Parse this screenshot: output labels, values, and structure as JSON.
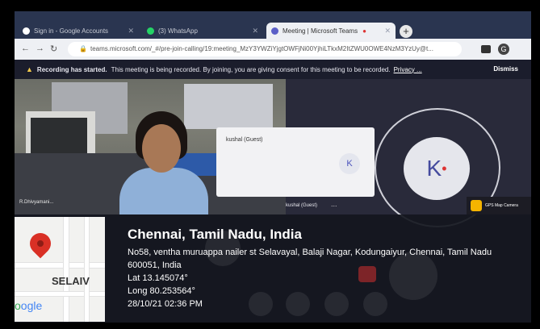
{
  "browser": {
    "tabs": [
      {
        "label": "Sign in - Google Accounts",
        "icon": "google-icon",
        "active": false
      },
      {
        "label": "(3) WhatsApp",
        "icon": "whatsapp-icon",
        "active": false
      },
      {
        "label": "Meeting | Microsoft Teams",
        "icon": "teams-icon",
        "active": true
      }
    ],
    "url": "teams.microsoft.com/_#/pre-join-calling/19:meeting_MzY3YWZiYjgtOWFjNi00YjhiLTkxM2ItZWU0OWE4NzM3YzUy@t...",
    "profile_initial": "G"
  },
  "banner": {
    "bold": "Recording has started.",
    "text": "This meeting is being recorded. By joining, you are giving consent for this meeting to be recorded.",
    "link": "Privacy ...",
    "dismiss": "Dismiss"
  },
  "meeting": {
    "guest_name": "kushal (Guest)",
    "guest_initial": "K",
    "big_initial": "K",
    "tile_label": "kushal (Guest)",
    "camera_tag": "R.Dhivyamani...",
    "more_dots": "..."
  },
  "gps": {
    "app_label": "GPS Map Camera",
    "map_place": "SELAIV",
    "map_brand_start": "o",
    "map_brand_rest": "ogle",
    "city": "Chennai, Tamil Nadu, India",
    "address": "No58, ventha muruappa nailer st Selavayal, Balaji Nagar, Kodungaiyur, Chennai, Tamil Nadu 600051, India",
    "lat": "Lat 13.145074°",
    "long": "Long 80.253564°",
    "datetime": "28/10/21 02:36 PM"
  }
}
